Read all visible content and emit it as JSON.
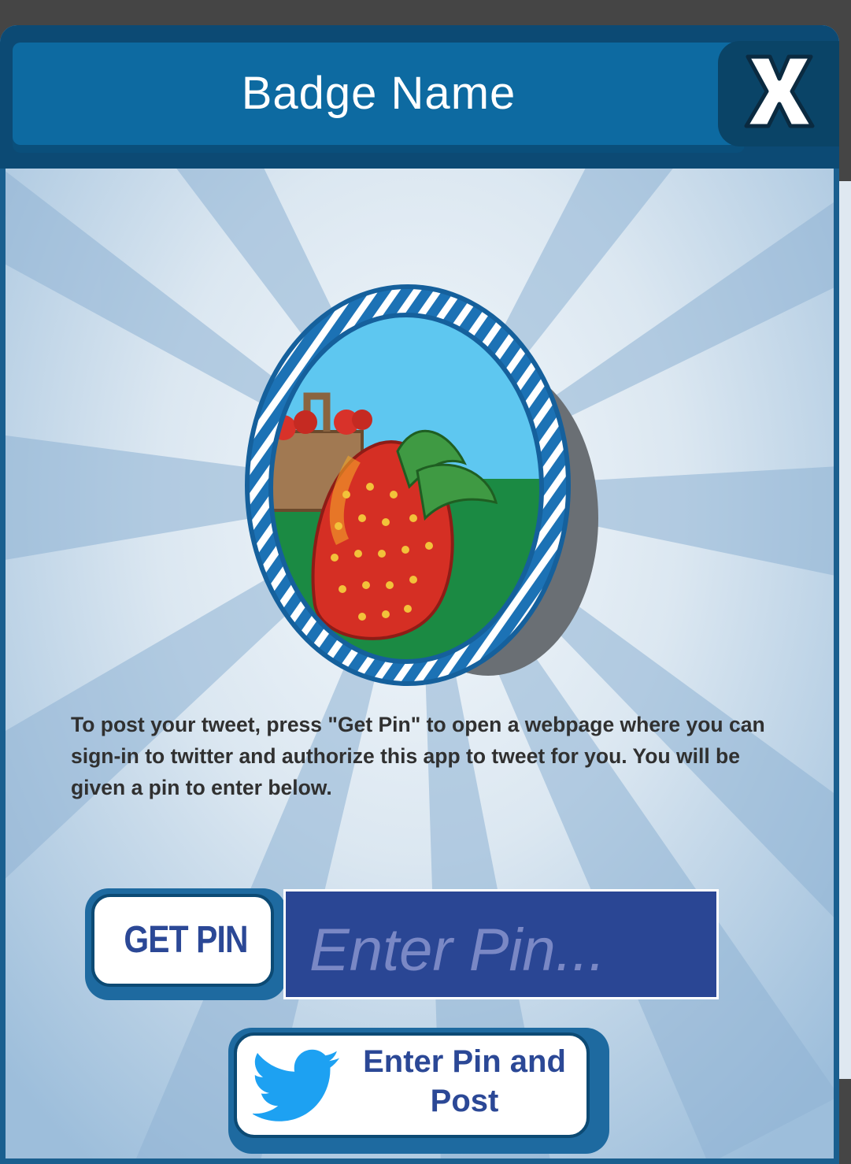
{
  "dialog": {
    "title": "Badge Name",
    "close_label": "X",
    "close_icon": "close-x-icon"
  },
  "badge": {
    "image": "strawberry-badge",
    "ring_color": "#1c72b5",
    "sky_color": "#5ec7f0",
    "field_color": "#1b8a43"
  },
  "message": "To post your tweet, press \"Get Pin\" to open a webpage where you can sign-in to twitter and authorize this app to tweet for you. You will be given a pin to enter below.",
  "pin": {
    "get_pin_label": "GET PIN",
    "input_value": "",
    "input_placeholder": "Enter Pin..."
  },
  "post": {
    "label_line1": "Enter Pin and",
    "label_line2": "Post",
    "icon": "twitter-bird-icon",
    "icon_color": "#1da1f2"
  },
  "colors": {
    "header": "#0d6aa1",
    "panel_light": "#e4edf5",
    "panel_dark": "#7aa6cc",
    "button_text": "#2b4896",
    "input_bg": "#2a4694"
  }
}
